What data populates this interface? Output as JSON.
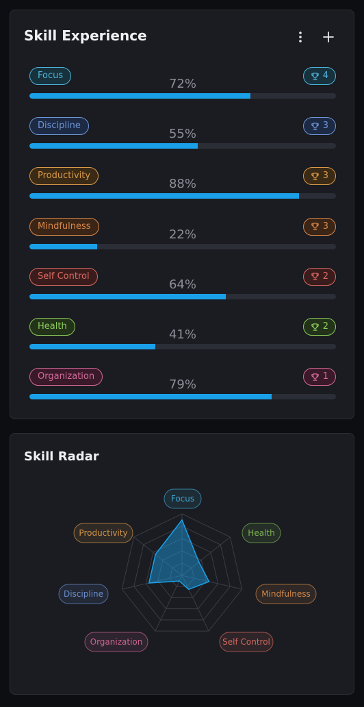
{
  "experience": {
    "title": "Skill Experience",
    "menu_icon": "more-vertical-icon",
    "add_icon": "plus-icon",
    "skills": [
      {
        "name": "Focus",
        "percent": "72%",
        "value": 72,
        "trophies": "4",
        "color": "#4fb3d9",
        "bg": "#17323d"
      },
      {
        "name": "Discipline",
        "percent": "55%",
        "value": 55,
        "trophies": "3",
        "color": "#6f95d6",
        "bg": "#1c2a44"
      },
      {
        "name": "Productivity",
        "percent": "88%",
        "value": 88,
        "trophies": "3",
        "color": "#d99a4a",
        "bg": "#3a2a16"
      },
      {
        "name": "Mindfulness",
        "percent": "22%",
        "value": 22,
        "trophies": "3",
        "color": "#d9884a",
        "bg": "#3a2516"
      },
      {
        "name": "Self Control",
        "percent": "64%",
        "value": 64,
        "trophies": "2",
        "color": "#d96a62",
        "bg": "#3a1c1c"
      },
      {
        "name": "Health",
        "percent": "41%",
        "value": 41,
        "trophies": "2",
        "color": "#8cc95a",
        "bg": "#23331a"
      },
      {
        "name": "Organization",
        "percent": "79%",
        "value": 79,
        "trophies": "1",
        "color": "#d46a9a",
        "bg": "#3a1a2a"
      }
    ]
  },
  "radar": {
    "title": "Skill Radar",
    "axes": [
      {
        "name": "Focus",
        "value": 72,
        "color": "#3ea6d0"
      },
      {
        "name": "Health",
        "value": 41,
        "color": "#7fb552"
      },
      {
        "name": "Mindfulness",
        "value": 22,
        "color": "#d0874a"
      },
      {
        "name": "Self Control",
        "value": 64,
        "color": "#d0675e"
      },
      {
        "name": "Organization",
        "value": 79,
        "color": "#c96591"
      },
      {
        "name": "Discipline",
        "value": 55,
        "color": "#6a8fcf"
      },
      {
        "name": "Productivity",
        "value": 88,
        "color": "#d0954a"
      }
    ],
    "plotted": [
      90,
      35,
      45,
      25,
      10,
      55,
      55
    ]
  }
}
